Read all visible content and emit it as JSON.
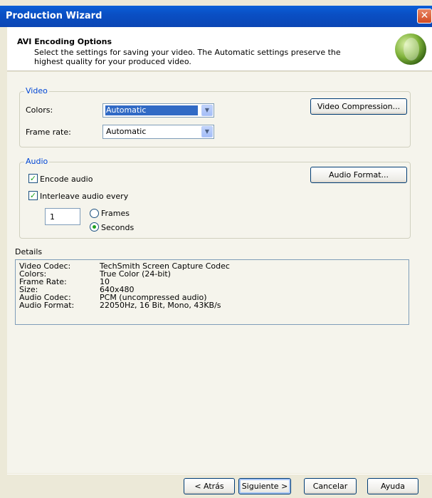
{
  "window": {
    "title": "Production Wizard",
    "close_glyph": "✕"
  },
  "header": {
    "title": "AVI Encoding Options",
    "description": "Select the settings for saving your video.  The Automatic settings preserve the highest quality for your produced video."
  },
  "video": {
    "group_label": "Video",
    "colors_label": "Colors:",
    "colors_value": "Automatic",
    "frame_rate_label": "Frame rate:",
    "frame_rate_value": "Automatic",
    "compression_button": "Video Compression..."
  },
  "audio": {
    "group_label": "Audio",
    "encode_label": "Encode audio",
    "encode_checked": true,
    "interleave_label": "Interleave audio every",
    "interleave_checked": true,
    "interleave_value": "1",
    "frames_label": "Frames",
    "seconds_label": "Seconds",
    "selected_unit": "Seconds",
    "format_button": "Audio Format..."
  },
  "details": {
    "label": "Details",
    "rows": [
      {
        "key": "Video Codec:",
        "value": "TechSmith Screen Capture Codec"
      },
      {
        "key": "Colors:",
        "value": "True Color (24-bit)"
      },
      {
        "key": "Frame Rate:",
        "value": "10"
      },
      {
        "key": "Size:",
        "value": "640x480"
      },
      {
        "key": "Audio Codec:",
        "value": "PCM (uncompressed audio)"
      },
      {
        "key": "Audio Format:",
        "value": "22050Hz, 16 Bit, Mono, 43KB/s"
      }
    ]
  },
  "footer": {
    "back_button": "< Atrás",
    "next_button": "Siguiente >",
    "cancel_button": "Cancelar",
    "help_button": "Ayuda"
  },
  "icons": {
    "check": "✓",
    "dropdown": "▼"
  }
}
